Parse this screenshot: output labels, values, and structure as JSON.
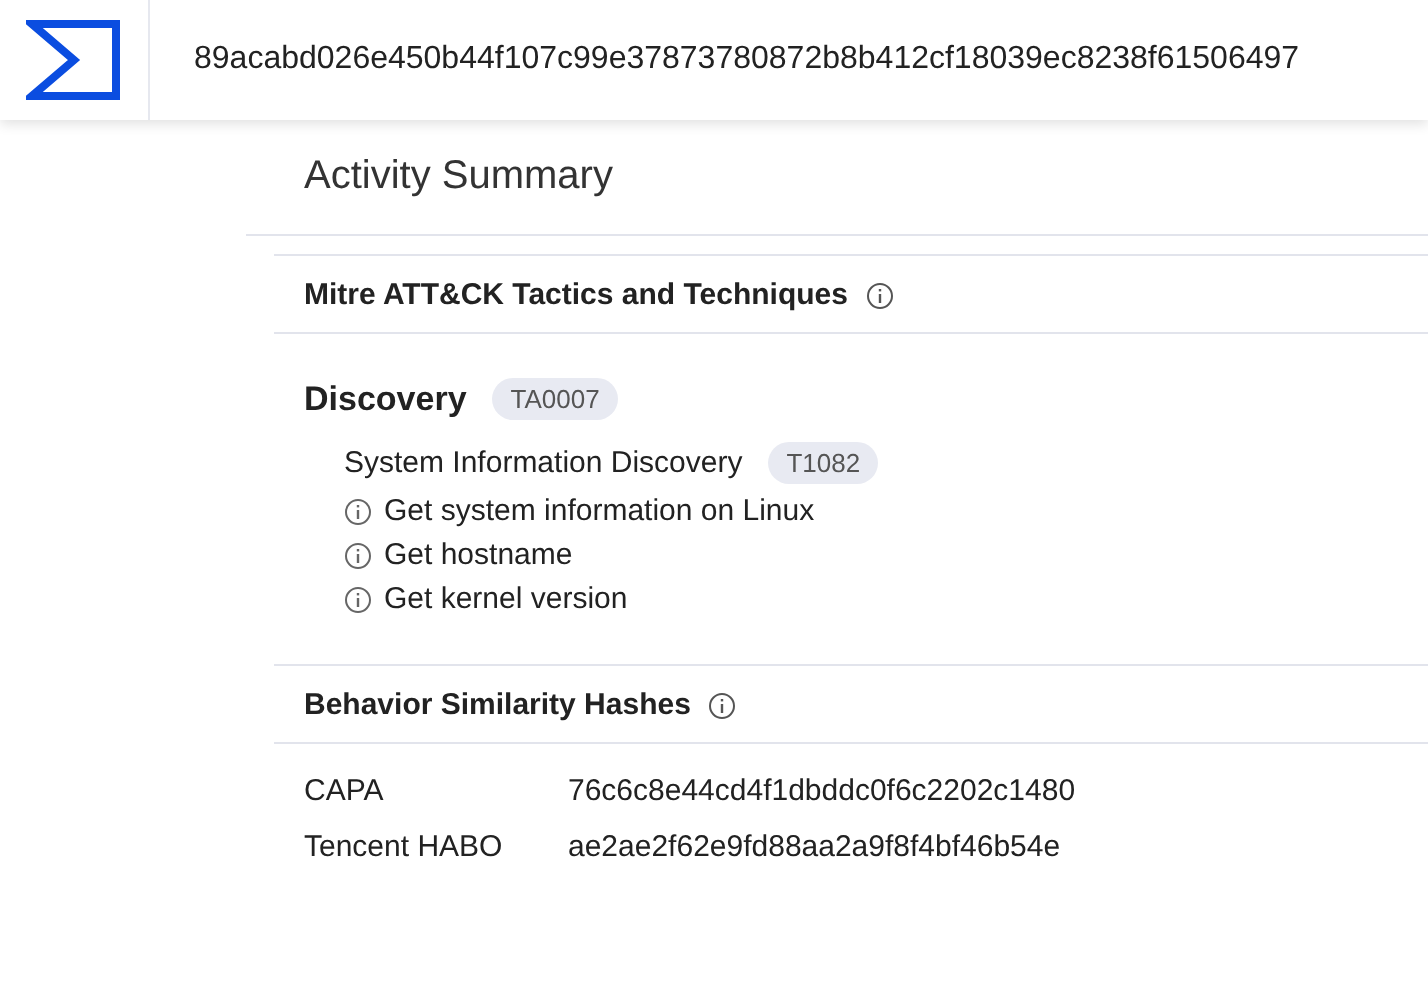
{
  "header": {
    "title": "89acabd026e450b44f107c99e37873780872b8b412cf18039ec8238f61506497"
  },
  "page_title": "Activity Summary",
  "mitre": {
    "title": "Mitre ATT&CK Tactics and Techniques",
    "tactics": [
      {
        "name": "Discovery",
        "id": "TA0007",
        "techniques": [
          {
            "name": "System Information Discovery",
            "id": "T1082",
            "behaviors": [
              "Get system information on Linux",
              "Get hostname",
              "Get kernel version"
            ]
          }
        ]
      }
    ]
  },
  "hashes": {
    "title": "Behavior Similarity Hashes",
    "rows": [
      {
        "name": "CAPA",
        "value": "76c6c8e44cd4f1dbddc0f6c2202c1480"
      },
      {
        "name": "Tencent HABO",
        "value": "ae2ae2f62e9fd88aa2a9f8f4bf46b54e"
      }
    ]
  }
}
